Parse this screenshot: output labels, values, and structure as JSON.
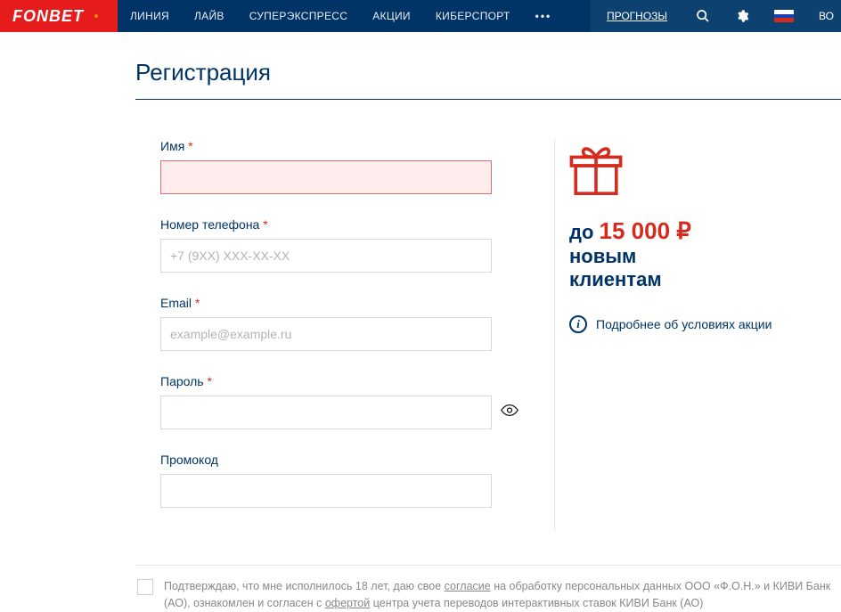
{
  "header": {
    "logo": "FONBET",
    "nav": [
      "ЛИНИЯ",
      "ЛАЙВ",
      "СУПЕРЭКСПРЕСС",
      "АКЦИИ",
      "КИБЕРСПОРТ"
    ],
    "prognozy": "ПРОГНОЗЫ",
    "login_partial": "ВО"
  },
  "page": {
    "title": "Регистрация",
    "fields": {
      "name_label": "Имя",
      "phone_label": "Номер телефона",
      "phone_placeholder": "+7 (9XX) XXX-XX-XX",
      "email_label": "Email",
      "email_placeholder": "example@example.ru",
      "password_label": "Пароль",
      "promo_label": "Промокод"
    },
    "required_mark": "*"
  },
  "promo": {
    "prefix": "до",
    "amount": "15 000 ₽",
    "line2a": "новым",
    "line2b": "клиентам",
    "more": "Подробнее об условиях акции"
  },
  "consent": {
    "part1": "Подтверждаю, что мне исполнилось 18 лет, даю свое ",
    "link1": "согласие",
    "part2": " на обработку персональных данных ООО «Ф.О.Н.» и КИВИ Банк (АО), ознакомлен и согласен с ",
    "link2": "офертой",
    "part3": " центра учета переводов интерактивных ставок КИВИ Банк (АО)"
  }
}
